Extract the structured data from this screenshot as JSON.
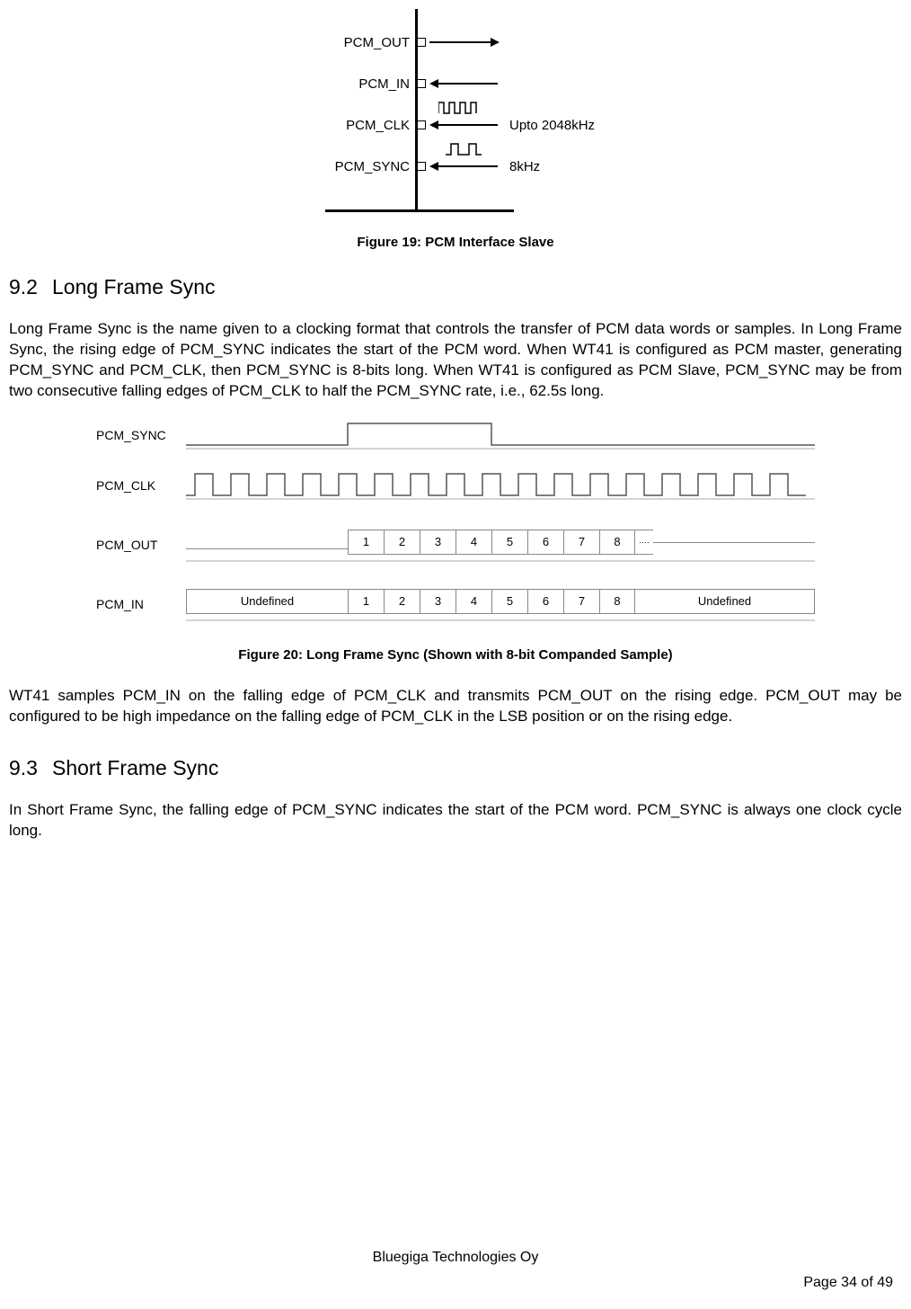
{
  "figure19": {
    "signals": {
      "pcm_out": "PCM_OUT",
      "pcm_in": "PCM_IN",
      "pcm_clk": "PCM_CLK",
      "pcm_sync": "PCM_SYNC"
    },
    "notes": {
      "clk": "Upto 2048kHz",
      "sync": "8kHz"
    },
    "caption": "Figure 19: PCM Interface Slave"
  },
  "section92": {
    "number": "9.2",
    "title": "Long Frame Sync",
    "para": "Long Frame Sync is the name given to a clocking format that controls the transfer of PCM data words or samples. In Long Frame Sync, the rising edge of PCM_SYNC indicates the start of the PCM word. When WT41 is configured as PCM master, generating PCM_SYNC and PCM_CLK, then PCM_SYNC is 8-bits long. When WT41 is configured as PCM Slave, PCM_SYNC may be from two consecutive falling edges of PCM_CLK to half the PCM_SYNC rate, i.e., 62.5s long."
  },
  "figure20": {
    "labels": {
      "sync": "PCM_SYNC",
      "clk": "PCM_CLK",
      "out": "PCM_OUT",
      "in": "PCM_IN"
    },
    "bits": [
      "1",
      "2",
      "3",
      "4",
      "5",
      "6",
      "7",
      "8"
    ],
    "undefined": "Undefined",
    "caption": "Figure 20: Long Frame Sync (Shown with 8-bit Companded Sample)"
  },
  "para_after_fig20": "WT41 samples PCM_IN on the falling edge of PCM_CLK and transmits PCM_OUT on the rising edge. PCM_OUT may be configured to be high impedance on the falling edge of PCM_CLK in the LSB position or on the rising edge.",
  "section93": {
    "number": "9.3",
    "title": "Short Frame Sync",
    "para": "In Short Frame Sync, the falling edge of PCM_SYNC indicates the start of the PCM word. PCM_SYNC is always one clock cycle long."
  },
  "footer": {
    "company": "Bluegiga Technologies Oy",
    "page": "Page 34 of 49"
  }
}
